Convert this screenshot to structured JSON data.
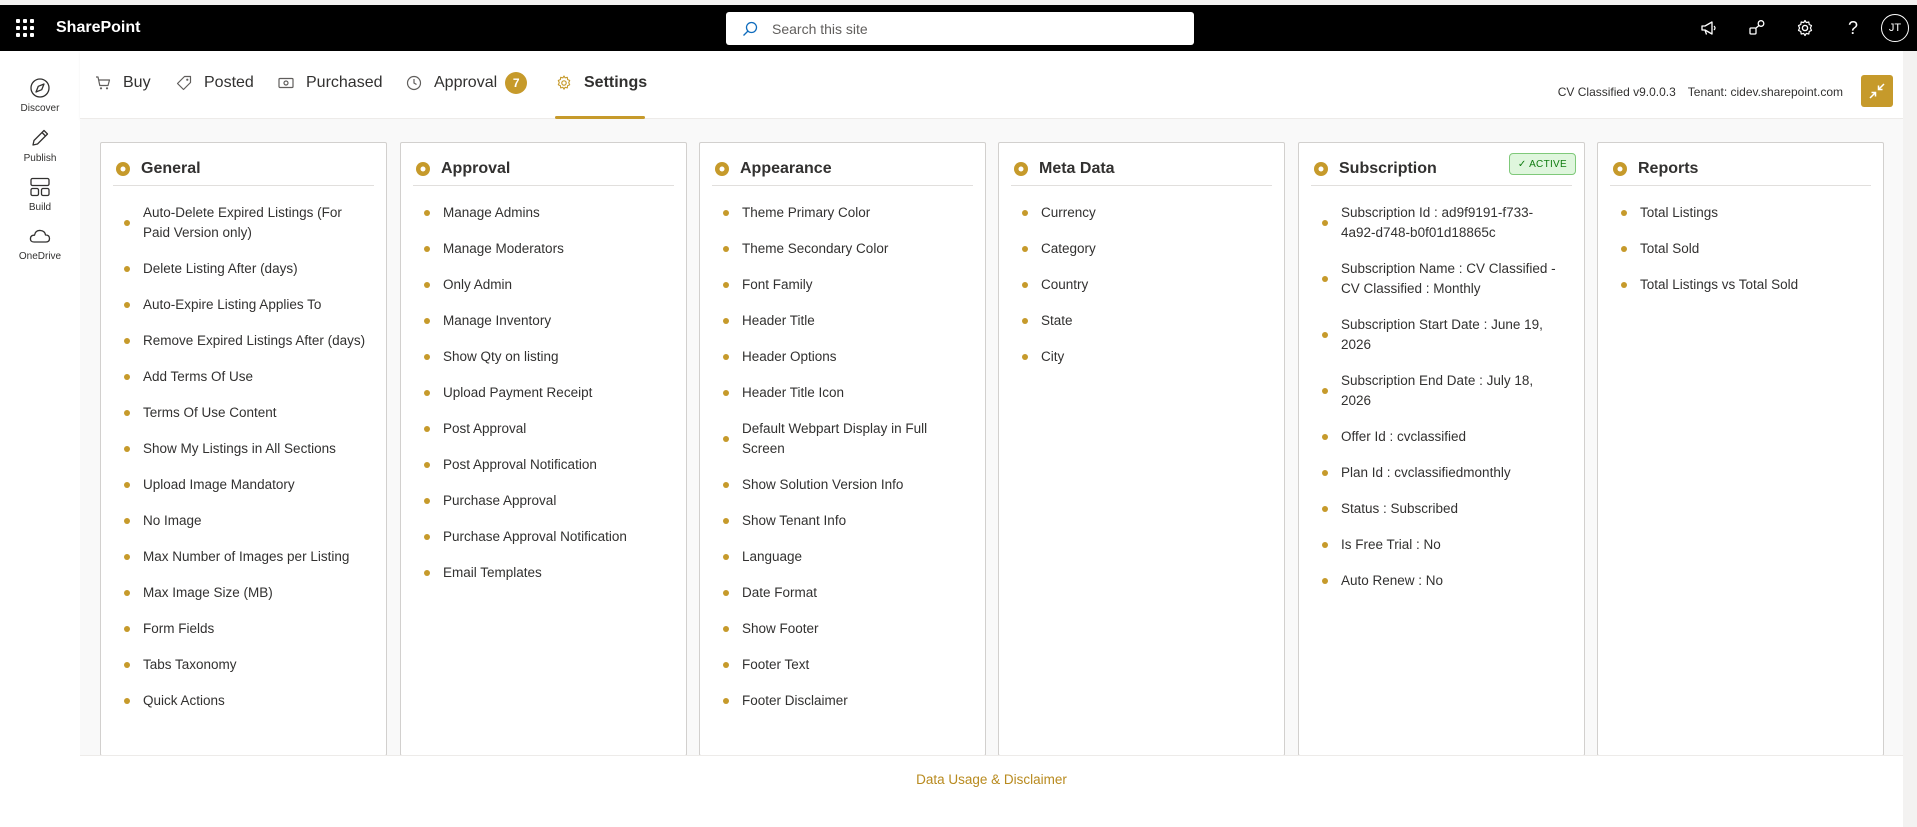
{
  "suite": {
    "brand": "SharePoint",
    "search_placeholder": "Search this site",
    "user_initials": "JT"
  },
  "appbar": {
    "items": [
      {
        "label": "Discover",
        "icon": "compass-icon"
      },
      {
        "label": "Publish",
        "icon": "pen-icon"
      },
      {
        "label": "Build",
        "icon": "layout-icon"
      },
      {
        "label": "OneDrive",
        "icon": "cloud-icon"
      }
    ]
  },
  "tabs": {
    "buy": "Buy",
    "posted": "Posted",
    "purchased": "Purchased",
    "approval": "Approval",
    "approval_count": "7",
    "settings": "Settings"
  },
  "header": {
    "version": "CV Classified v9.0.0.3",
    "tenant": "Tenant: cidev.sharepoint.com"
  },
  "cards": {
    "general": {
      "title": "General",
      "items": [
        "Auto-Delete Expired Listings (For Paid Version only)",
        "Delete Listing After (days)",
        "Auto-Expire Listing Applies To",
        "Remove Expired Listings After (days)",
        "Add Terms Of Use",
        "Terms Of Use Content",
        "Show My Listings in All Sections",
        "Upload Image Mandatory",
        "No Image",
        "Max Number of Images per Listing",
        "Max Image Size (MB)",
        "Form Fields",
        "Tabs Taxonomy",
        "Quick Actions"
      ]
    },
    "approval": {
      "title": "Approval",
      "items": [
        "Manage Admins",
        "Manage Moderators",
        "Only Admin",
        "Manage Inventory",
        "Show Qty on listing",
        "Upload Payment Receipt",
        "Post Approval",
        "Post Approval Notification",
        "Purchase Approval",
        "Purchase Approval Notification",
        "Email Templates"
      ]
    },
    "appearance": {
      "title": "Appearance",
      "items": [
        "Theme Primary Color",
        "Theme Secondary Color",
        "Font Family",
        "Header Title",
        "Header Options",
        "Header Title Icon",
        "Default Webpart Display in Full Screen",
        "Show Solution Version Info",
        "Show Tenant Info",
        "Language",
        "Date Format",
        "Show Footer",
        "Footer Text",
        "Footer Disclaimer"
      ]
    },
    "metadata": {
      "title": "Meta Data",
      "items": [
        "Currency",
        "Category",
        "Country",
        "State",
        "City"
      ]
    },
    "subscription": {
      "title": "Subscription",
      "status_badge": "✓ ACTIVE",
      "items": [
        "Subscription Id : ad9f9191-f733-4a92-d748-b0f01d18865c",
        "Subscription Name : CV Classified - CV Classified : Monthly",
        "Subscription Start Date : June 19, 2026",
        "Subscription End Date : July 18, 2026",
        "Offer Id : cvclassified",
        "Plan Id : cvclassifiedmonthly",
        "Status : Subscribed",
        "Is Free Trial : No",
        "Auto Renew : No"
      ]
    },
    "reports": {
      "title": "Reports",
      "items": [
        "Total Listings",
        "Total Sold",
        "Total Listings vs Total Sold"
      ]
    }
  },
  "footer": {
    "link": "Data Usage & Disclaimer"
  },
  "colors": {
    "accent": "#c69a2b",
    "suite_bar": "#000000",
    "active_green": "#107c10"
  }
}
